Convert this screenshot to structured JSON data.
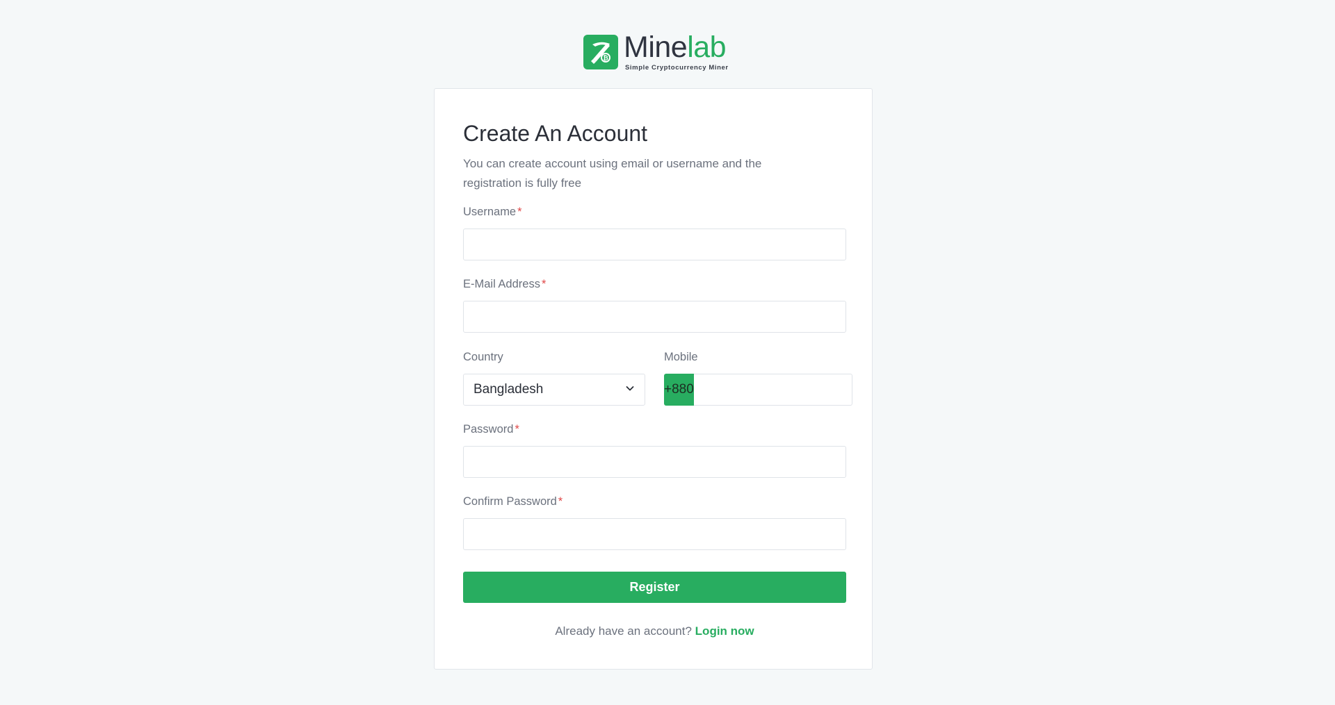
{
  "brand": {
    "name_prefix": "Mine",
    "name_suffix": "lab",
    "tagline": "Simple Cryptocurrency Miner",
    "accent_color": "#28ad60"
  },
  "form": {
    "title": "Create An Account",
    "subtitle": "You can create account using email or username and the registration is fully free",
    "required_marker": "*",
    "username": {
      "label": "Username",
      "value": "",
      "placeholder": ""
    },
    "email": {
      "label": "E-Mail Address",
      "value": "",
      "placeholder": ""
    },
    "country": {
      "label": "Country",
      "selected": "Bangladesh"
    },
    "mobile": {
      "label": "Mobile",
      "code": "+880",
      "value": "",
      "placeholder": ""
    },
    "password": {
      "label": "Password",
      "value": "",
      "placeholder": ""
    },
    "confirm_password": {
      "label": "Confirm Password",
      "value": "",
      "placeholder": ""
    },
    "register_label": "Register",
    "login_prompt": "Already have an account?",
    "login_link": "Login now"
  },
  "icons": {
    "logo": "pickaxe-icon",
    "country_dropdown": "chevron-down-icon"
  }
}
